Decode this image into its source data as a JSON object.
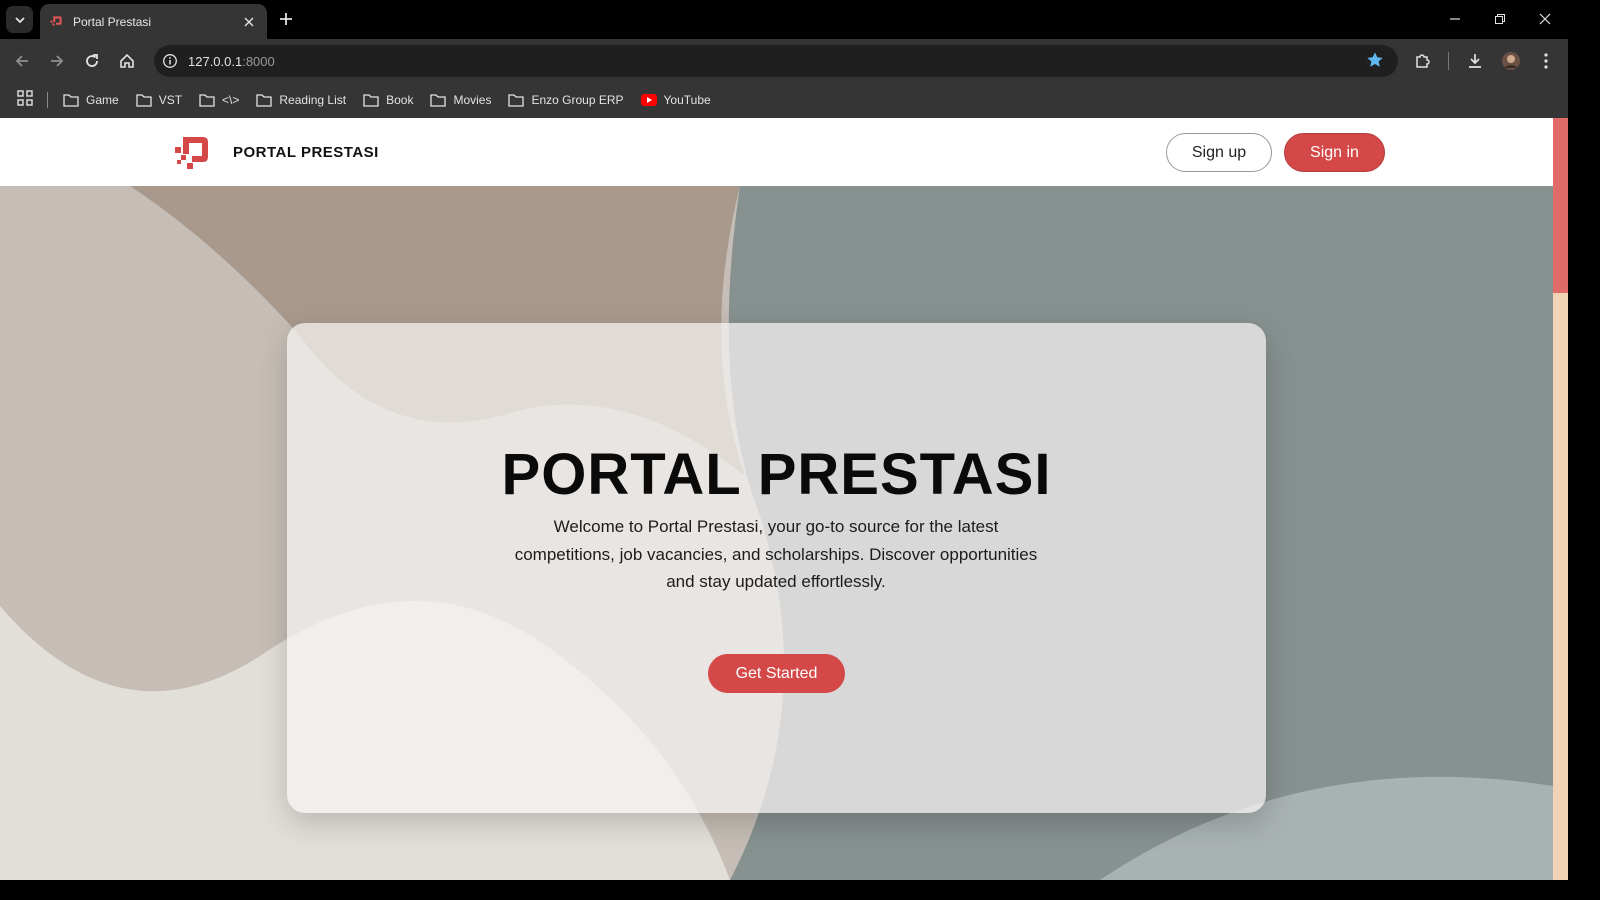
{
  "browser": {
    "tab_title": "Portal Prestasi",
    "url_host": "127.0.0.1",
    "url_port": ":8000",
    "bookmarks": [
      "Game",
      "VST",
      "<\\>",
      "Reading List",
      "Book",
      "Movies",
      "Enzo Group ERP",
      "YouTube"
    ]
  },
  "navbar": {
    "brand": "PORTAL PRESTASI",
    "signup_label": "Sign up",
    "signin_label": "Sign in"
  },
  "hero": {
    "title": "PORTAL PRESTASI",
    "description": "Welcome to Portal Prestasi, your go-to source for the latest competitions, job vacancies, and scholarships. Discover opportunities and stay updated effortlessly.",
    "cta_label": "Get Started"
  },
  "colors": {
    "accent": "#d44848",
    "scroll_thumb": "#e06a67",
    "scroll_track": "#f1d3b6"
  }
}
